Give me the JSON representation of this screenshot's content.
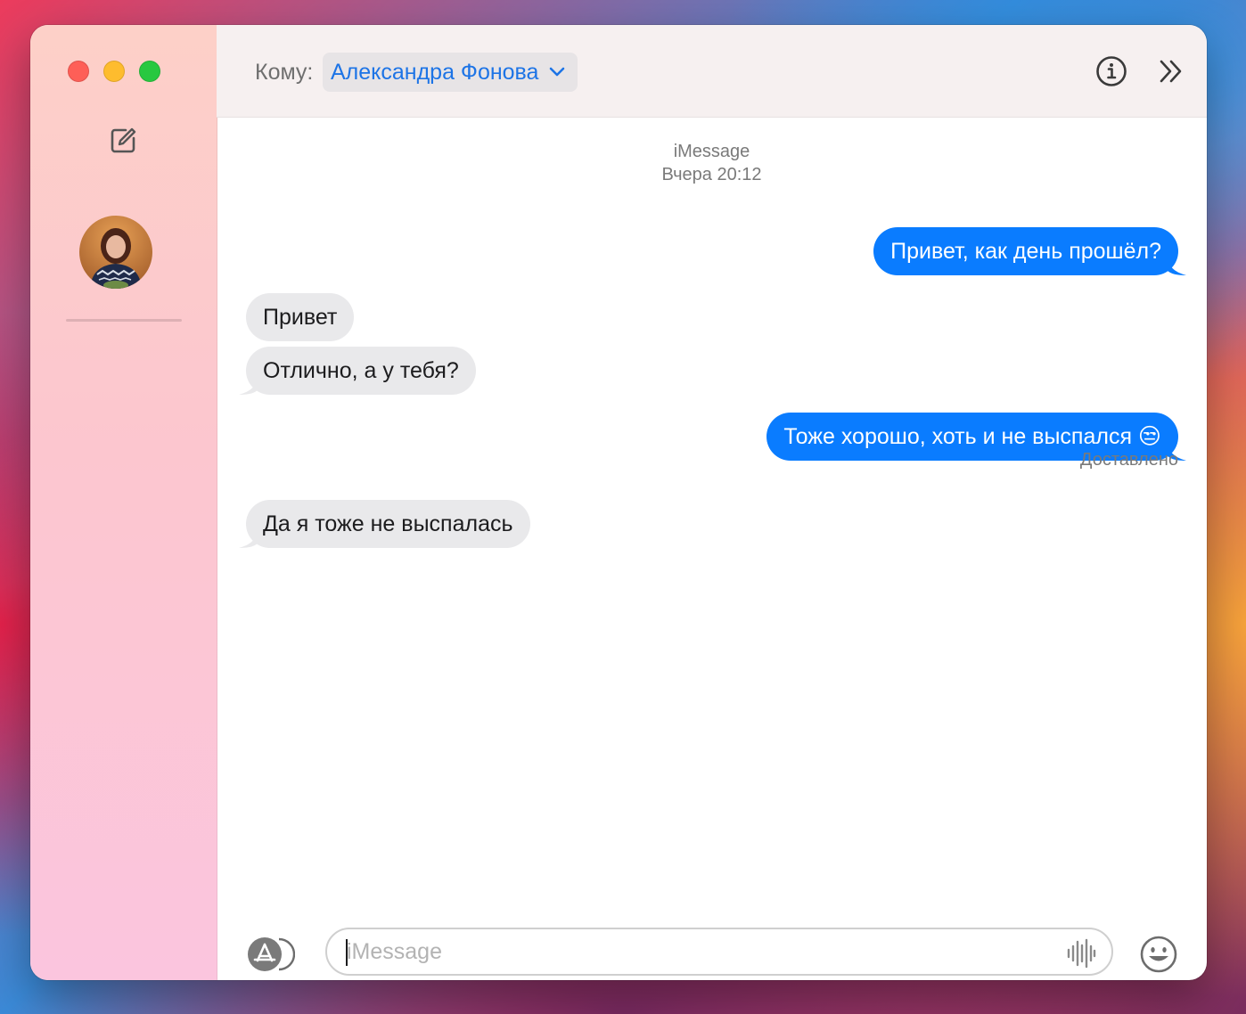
{
  "window": {
    "traffic_lights": [
      "close",
      "minimize",
      "zoom"
    ],
    "compose_icon": "compose-icon",
    "avatar_icon": "contact-avatar"
  },
  "header": {
    "to_label": "Кому:",
    "recipient": "Александра Фонова",
    "recipient_chevron_icon": "chevron-down-icon",
    "info_icon": "info-icon",
    "expand_icon": "chevrons-right-icon"
  },
  "conversation": {
    "service": "iMessage",
    "timestamp": "Вчера 20:12",
    "messages": [
      {
        "direction": "out",
        "text": "Привет, как день прошёл?"
      },
      {
        "direction": "in",
        "text": "Привет"
      },
      {
        "direction": "in",
        "text": "Отлично, а у тебя?"
      },
      {
        "direction": "out",
        "text": "Тоже хорошо, хоть и не выспался 😒"
      },
      {
        "direction": "in",
        "text": "Да я тоже не выспалась"
      }
    ],
    "delivered_status": "Доставлено"
  },
  "composer": {
    "apps_icon": "app-store-icon",
    "placeholder": "iMessage",
    "value": "",
    "voice_icon": "waveform-icon",
    "emoji_icon": "emoji-icon"
  },
  "colors": {
    "outgoing_bubble": "#0a7cff",
    "incoming_bubble": "#e9e9eb",
    "accent": "#1d74e6"
  }
}
